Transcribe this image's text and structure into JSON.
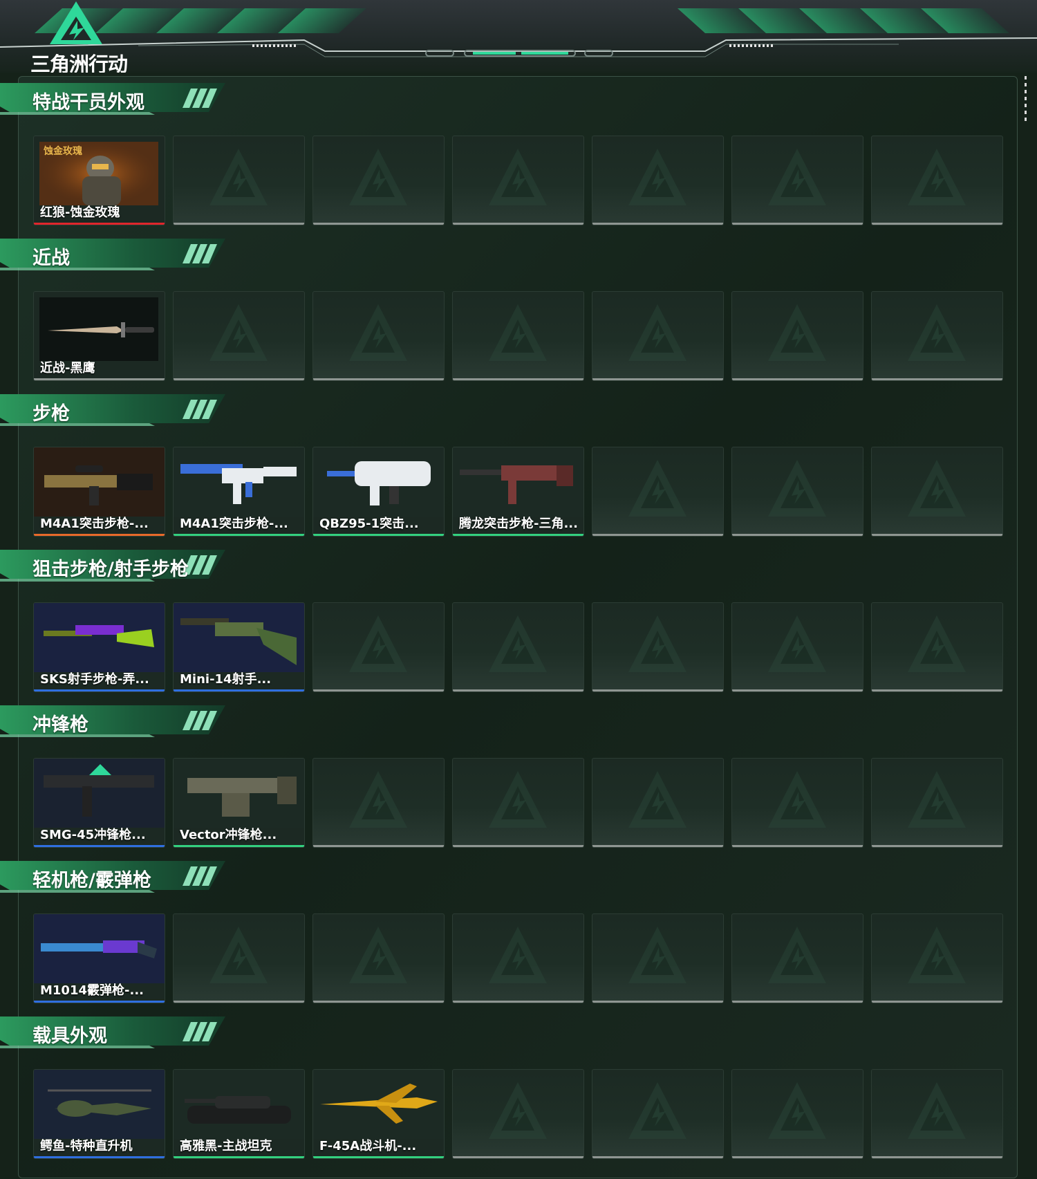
{
  "app": {
    "logo_text": "三角洲行动"
  },
  "colors": {
    "accent": "#2fd89a",
    "rarity_red": "#e0262c",
    "rarity_orange": "#e86a2a",
    "rarity_green": "#33d07f",
    "rarity_blue": "#2f6fe0",
    "empty_bar": "#8f9692"
  },
  "sections": [
    {
      "title": "特战干员外观",
      "items": [
        {
          "label": "红狼-蚀金玫瑰",
          "rarity": "red",
          "image": "operator-red-wolf",
          "badge": "蚀金玫瑰"
        }
      ]
    },
    {
      "title": "近战",
      "items": [
        {
          "label": "近战-黑鹰",
          "rarity": "none",
          "image": "knife"
        }
      ]
    },
    {
      "title": "步枪",
      "items": [
        {
          "label": "M4A1突击步枪-...",
          "rarity": "orange",
          "image": "rifle-gold"
        },
        {
          "label": "M4A1突击步枪-...",
          "rarity": "green",
          "image": "rifle-blue-white"
        },
        {
          "label": "QBZ95-1突击...",
          "rarity": "green",
          "image": "bullpup-white"
        },
        {
          "label": "腾龙突击步枪-三角...",
          "rarity": "green",
          "image": "rifle-red-camo"
        }
      ]
    },
    {
      "title": "狙击步枪/射手步枪",
      "items": [
        {
          "label": "SKS射手步枪-弄...",
          "rarity": "blue",
          "image": "sks-purple-lime"
        },
        {
          "label": "Mini-14射手...",
          "rarity": "blue",
          "image": "mini14-green"
        }
      ]
    },
    {
      "title": "冲锋枪",
      "items": [
        {
          "label": "SMG-45冲锋枪...",
          "rarity": "blue",
          "image": "smg-dark"
        },
        {
          "label": "Vector冲锋枪...",
          "rarity": "green",
          "image": "vector-camo"
        }
      ]
    },
    {
      "title": "轻机枪/霰弹枪",
      "items": [
        {
          "label": "M1014霰弹枪-...",
          "rarity": "blue",
          "image": "shotgun-purple"
        }
      ]
    },
    {
      "title": "载具外观",
      "items": [
        {
          "label": "鳄鱼-特种直升机",
          "rarity": "blue",
          "image": "helicopter"
        },
        {
          "label": "高雅黑-主战坦克",
          "rarity": "green",
          "image": "tank"
        },
        {
          "label": "F-45A战斗机-...",
          "rarity": "green",
          "image": "jet-yellow"
        }
      ]
    }
  ],
  "slots_per_row": 7
}
